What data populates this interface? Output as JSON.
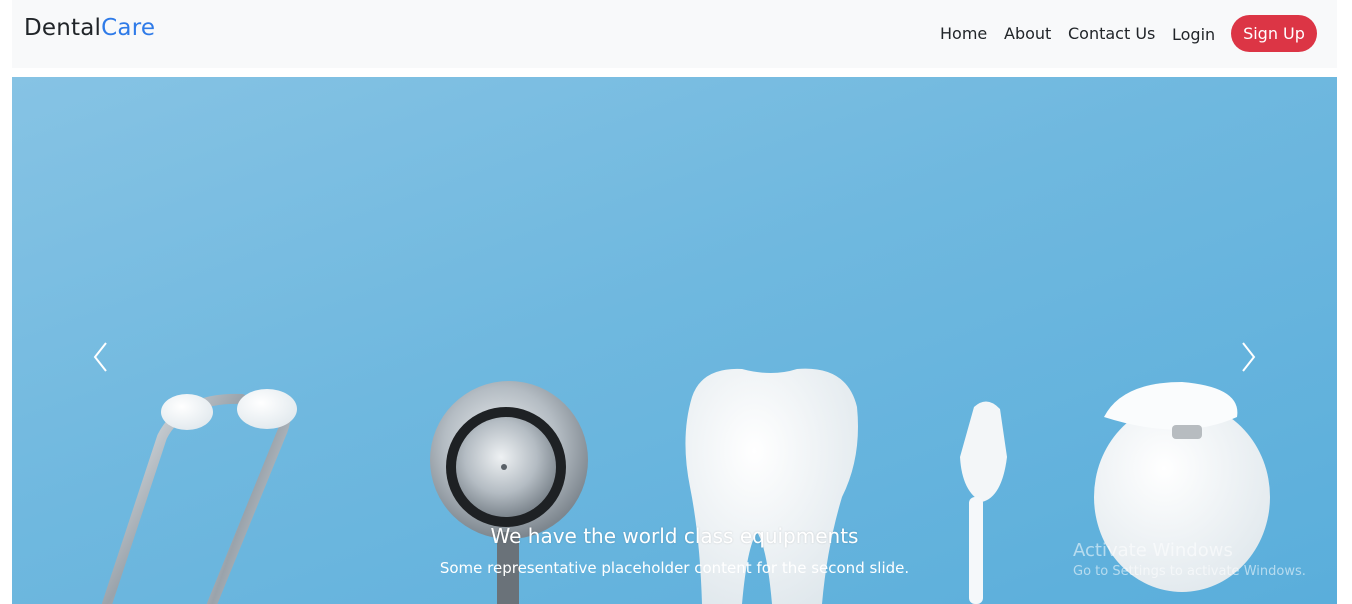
{
  "navbar": {
    "brand_main": "Dental",
    "brand_accent": "Care",
    "links": [
      "Home",
      "About",
      "Contact Us",
      "Login"
    ],
    "signup_label": "Sign Up"
  },
  "carousel": {
    "caption_title": "We have the world class equipments",
    "caption_text": "Some representative placeholder content for the second slide."
  },
  "watermark": {
    "line1": "Activate Windows",
    "line2": "Go to Settings to activate Windows."
  },
  "colors": {
    "brand_accent": "#2f7be8",
    "signup_bg": "#dc3545",
    "navbar_bg": "#f8f9fa",
    "slide_bg": "#6fb8df"
  },
  "icons": [
    "chevron-left-icon",
    "chevron-right-icon"
  ]
}
